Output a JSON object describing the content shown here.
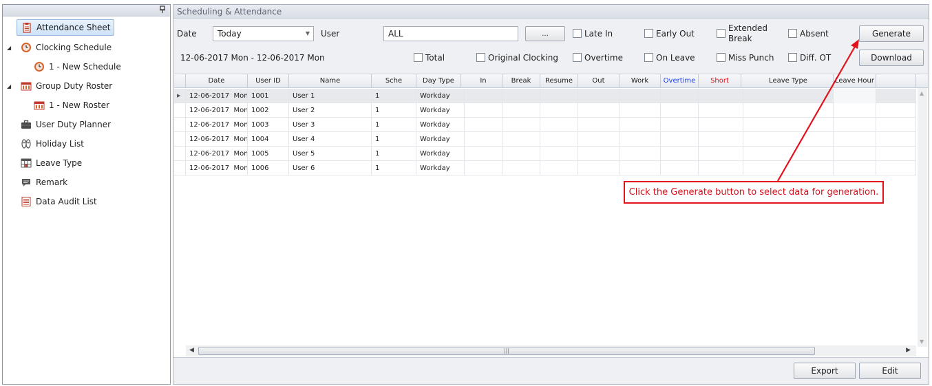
{
  "sidebar": {
    "pin_icon": "pin-icon",
    "items": [
      {
        "label": "Attendance Sheet",
        "icon": "clipboard-icon"
      },
      {
        "label": "Clocking Schedule",
        "icon": "clock-icon"
      },
      {
        "label": "1 - New Schedule",
        "icon": "clock-icon"
      },
      {
        "label": "Group Duty Roster",
        "icon": "calendar-icon"
      },
      {
        "label": "1 - New Roster",
        "icon": "calendar-icon"
      },
      {
        "label": "User Duty Planner",
        "icon": "briefcase-icon"
      },
      {
        "label": "Holiday List",
        "icon": "sandals-icon"
      },
      {
        "label": "Leave Type",
        "icon": "grid-icon"
      },
      {
        "label": "Remark",
        "icon": "comment-icon"
      },
      {
        "label": "Data Audit List",
        "icon": "list-icon"
      }
    ]
  },
  "main": {
    "title": "Scheduling & Attendance",
    "filters": {
      "date_label": "Date",
      "date_value": "Today",
      "user_label": "User",
      "user_value": "ALL",
      "browse_label": "...",
      "date_range": "12-06-2017 Mon - 12-06-2017 Mon"
    },
    "checkboxes": {
      "late_in": "Late In",
      "early_out": "Early Out",
      "extended_break_1": "Extended",
      "extended_break_2": "Break",
      "absent": "Absent",
      "total": "Total",
      "original_clocking": "Original Clocking",
      "overtime": "Overtime",
      "on_leave": "On Leave",
      "miss_punch": "Miss Punch",
      "diff_ot": "Diff. OT"
    },
    "buttons": {
      "generate": "Generate",
      "download": "Download",
      "export": "Export",
      "edit": "Edit"
    },
    "grid": {
      "columns": [
        "Date",
        "User ID",
        "Name",
        "Sche",
        "Day Type",
        "In",
        "Break",
        "Resume",
        "Out",
        "Work",
        "Overtime",
        "Short",
        "Leave Type",
        "Leave Hour"
      ],
      "rows": [
        {
          "date": "12-06-2017",
          "day": "Mon",
          "user_id": "1001",
          "name": "User 1",
          "sche": "1",
          "day_type": "Workday"
        },
        {
          "date": "12-06-2017",
          "day": "Mon",
          "user_id": "1002",
          "name": "User 2",
          "sche": "1",
          "day_type": "Workday"
        },
        {
          "date": "12-06-2017",
          "day": "Mon",
          "user_id": "1003",
          "name": "User 3",
          "sche": "1",
          "day_type": "Workday"
        },
        {
          "date": "12-06-2017",
          "day": "Mon",
          "user_id": "1004",
          "name": "User 4",
          "sche": "1",
          "day_type": "Workday"
        },
        {
          "date": "12-06-2017",
          "day": "Mon",
          "user_id": "1005",
          "name": "User 5",
          "sche": "1",
          "day_type": "Workday"
        },
        {
          "date": "12-06-2017",
          "day": "Mon",
          "user_id": "1006",
          "name": "User 6",
          "sche": "1",
          "day_type": "Workday"
        }
      ]
    }
  },
  "annotation": {
    "text": "Click the Generate button to select data for generation."
  },
  "colors": {
    "overtime_header": "#1b3ef0",
    "short_header": "#e0121a",
    "callout": "#e2121b",
    "selection": "#cfe3f7"
  }
}
